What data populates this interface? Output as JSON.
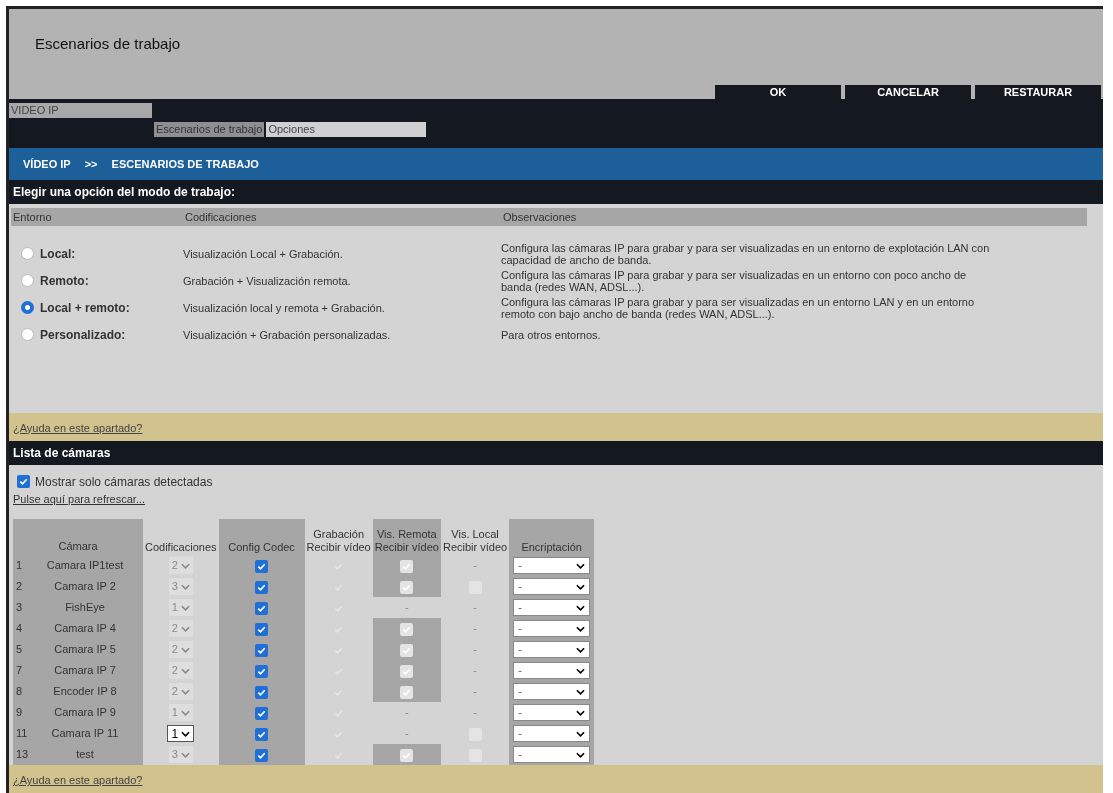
{
  "page_title": "Escenarios de trabajo",
  "buttons": [
    "OK",
    "CANCELAR",
    "RESTAURAR"
  ],
  "menu": {
    "section": "VIDEO IP",
    "tabs": [
      {
        "label": "Escenarios de trabajo",
        "selected": true
      },
      {
        "label": "Opciones",
        "selected": false
      }
    ]
  },
  "breadcrumb": [
    "VÍDEO IP",
    ">>",
    "ESCENARIOS DE TRABAJO"
  ],
  "mode_section": {
    "title": "Elegir una opción del modo de trabajo:",
    "columns": [
      "Entorno",
      "Codificaciones",
      "Observaciones"
    ],
    "options": [
      {
        "label": "Local:",
        "codecs": "Visualización Local + Grabación.",
        "notes": "Configura las cámaras IP para grabar y para ser visualizadas en un entorno de explotación LAN con capacidad de ancho de banda.",
        "selected": false
      },
      {
        "label": "Remoto:",
        "codecs": "Grabación + Visualización remota.",
        "notes": "Configura las cámaras IP para grabar y para ser visualizadas en un entorno con poco ancho de banda (redes WAN, ADSL...).",
        "selected": false
      },
      {
        "label": "Local + remoto:",
        "codecs": "Visualización local y remota + Grabación.",
        "notes": "Configura las cámaras IP para grabar y para ser visualizadas en un entorno LAN y en un entorno remoto con bajo ancho de banda (redes WAN, ADSL...).",
        "selected": true
      },
      {
        "label": "Personalizado:",
        "codecs": "Visualización + Grabación personalizadas.",
        "notes": "Para otros entornos.",
        "selected": false
      }
    ],
    "help_link": "¿Ayuda en este apartado?"
  },
  "cameras_section": {
    "title": "Lista de cámaras",
    "show_detected": {
      "label": "Mostrar solo cámaras detectadas",
      "checked": true
    },
    "refresh_link": "Pulse aquí para refrescar...",
    "columns": [
      [
        "Cámara"
      ],
      [
        "Codificaciones"
      ],
      [
        "Config Codec"
      ],
      [
        "Grabación",
        "Recibir vídeo"
      ],
      [
        "Vis. Remota",
        "Recibir vídeo"
      ],
      [
        "Vis. Local",
        "Recibir vídeo"
      ],
      [
        "Encriptación"
      ]
    ],
    "rows": [
      {
        "number": "1",
        "name": "Camara IP1test",
        "codec": {
          "value": "2",
          "disabled": true
        },
        "config_codec": true,
        "recording": true,
        "remote": {
          "kind": "checkbox",
          "checked": true
        },
        "local": {
          "kind": "text",
          "text": "-"
        },
        "encryption": "-"
      },
      {
        "number": "2",
        "name": "Camara IP 2",
        "codec": {
          "value": "3",
          "disabled": true
        },
        "config_codec": true,
        "recording": true,
        "remote": {
          "kind": "checkbox",
          "checked": true
        },
        "local": {
          "kind": "checkbox",
          "checked": false
        },
        "encryption": "-"
      },
      {
        "number": "3",
        "name": "FishEye",
        "codec": {
          "value": "1",
          "disabled": true
        },
        "config_codec": true,
        "recording": true,
        "remote": {
          "kind": "text",
          "text": "-"
        },
        "local": {
          "kind": "text",
          "text": "-"
        },
        "encryption": "-"
      },
      {
        "number": "4",
        "name": "Camara IP 4",
        "codec": {
          "value": "2",
          "disabled": true
        },
        "config_codec": true,
        "recording": true,
        "remote": {
          "kind": "checkbox",
          "checked": true
        },
        "local": {
          "kind": "text",
          "text": "-"
        },
        "encryption": "-"
      },
      {
        "number": "5",
        "name": "Camara IP 5",
        "codec": {
          "value": "2",
          "disabled": true
        },
        "config_codec": true,
        "recording": true,
        "remote": {
          "kind": "checkbox",
          "checked": true
        },
        "local": {
          "kind": "text",
          "text": "-"
        },
        "encryption": "-"
      },
      {
        "number": "7",
        "name": "Camara IP 7",
        "codec": {
          "value": "2",
          "disabled": true
        },
        "config_codec": true,
        "recording": true,
        "remote": {
          "kind": "checkbox",
          "checked": true
        },
        "local": {
          "kind": "text",
          "text": "-"
        },
        "encryption": "-"
      },
      {
        "number": "8",
        "name": "Encoder IP 8",
        "codec": {
          "value": "2",
          "disabled": true
        },
        "config_codec": true,
        "recording": true,
        "remote": {
          "kind": "checkbox",
          "checked": true
        },
        "local": {
          "kind": "text",
          "text": "-"
        },
        "encryption": "-"
      },
      {
        "number": "9",
        "name": "Camara IP 9",
        "codec": {
          "value": "1",
          "disabled": true
        },
        "config_codec": true,
        "recording": true,
        "remote": {
          "kind": "text",
          "text": "-"
        },
        "local": {
          "kind": "text",
          "text": "-"
        },
        "encryption": "-"
      },
      {
        "number": "11",
        "name": "Camara IP 11",
        "codec": {
          "value": "1",
          "disabled": false
        },
        "config_codec": true,
        "recording": true,
        "remote": {
          "kind": "text",
          "text": "-"
        },
        "local": {
          "kind": "checkbox",
          "checked": false
        },
        "encryption": "-"
      },
      {
        "number": "13",
        "name": "test",
        "codec": {
          "value": "3",
          "disabled": true
        },
        "config_codec": true,
        "recording": true,
        "remote": {
          "kind": "checkbox",
          "checked": true
        },
        "local": {
          "kind": "checkbox",
          "checked": false
        },
        "encryption": "-"
      }
    ],
    "help_link": "¿Ayuda en este apartado?"
  }
}
